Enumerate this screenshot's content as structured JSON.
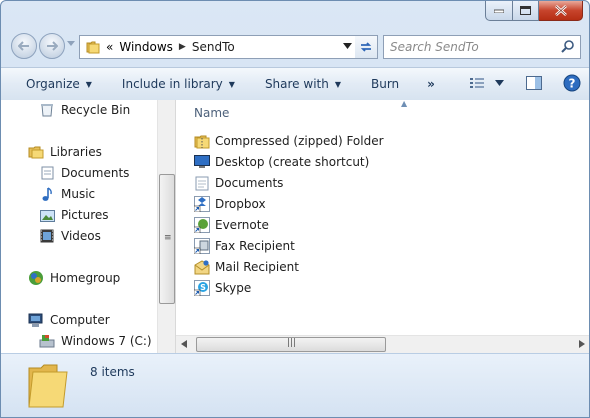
{
  "address": {
    "crumbs": [
      "Windows",
      "SendTo"
    ],
    "overflow": "«"
  },
  "search": {
    "placeholder": "Search SendTo"
  },
  "commands": {
    "organize": "Organize",
    "include": "Include in library",
    "share": "Share with",
    "burn": "Burn",
    "more": "»"
  },
  "nav": {
    "recycle": "Recycle Bin",
    "libraries": "Libraries",
    "documents": "Documents",
    "music": "Music",
    "pictures": "Pictures",
    "videos": "Videos",
    "homegroup": "Homegroup",
    "computer": "Computer",
    "drive": "Windows 7 (C:)"
  },
  "content": {
    "column": "Name",
    "files": [
      "Compressed (zipped) Folder",
      "Desktop (create shortcut)",
      "Documents",
      "Dropbox",
      "Evernote",
      "Fax Recipient",
      "Mail Recipient",
      "Skype"
    ]
  },
  "status": {
    "count": "8 items"
  },
  "colors": {
    "accent": "#1e395b",
    "chrome": "#c8dbef",
    "close": "#c7442c"
  }
}
